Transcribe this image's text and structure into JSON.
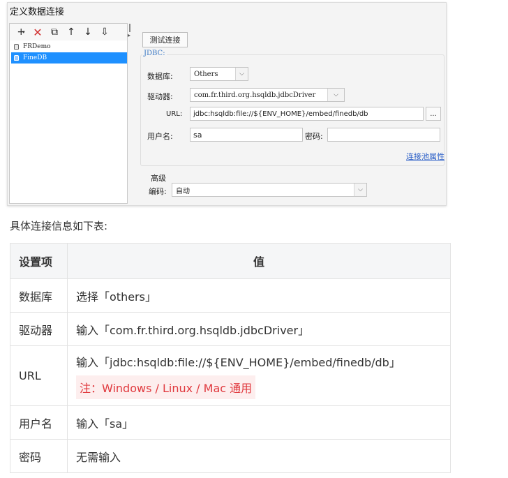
{
  "dialog": {
    "title": "定义数据连接",
    "toolbar": {
      "add": "+",
      "delete": "✕",
      "copy": "⧉",
      "up": "↑",
      "down": "↓",
      "sort": "⇩"
    },
    "connections": [
      "FRDemo",
      "FineDB"
    ],
    "test_button": "测试连接",
    "jdbc_legend": "JDBC:",
    "database_label": "数据库:",
    "database_value": "Others",
    "driver_label": "驱动器:",
    "driver_value": "com.fr.third.org.hsqldb.jdbcDriver",
    "url_label": "URL:",
    "url_value": "jdbc:hsqldb:file://${ENV_HOME}/embed/finedb/db",
    "url_browse": "...",
    "username_label": "用户名:",
    "username_value": "sa",
    "password_label": "密码:",
    "password_value": "",
    "pool_link": "连接池属性",
    "advanced_label": "高级",
    "encoding_label": "编码:",
    "encoding_value": "自动"
  },
  "intro": "具体连接信息如下表:",
  "table": {
    "headers": [
      "设置项",
      "值"
    ],
    "rows": [
      {
        "key": "数据库",
        "value": "选择「others」"
      },
      {
        "key": "驱动器",
        "value": "输入「com.fr.third.org.hsqldb.jdbcDriver」"
      },
      {
        "key": "URL",
        "value": "输入「jdbc:hsqldb:file://${ENV_HOME}/embed/finedb/db」",
        "note": "注：Windows / Linux / Mac 通用"
      },
      {
        "key": "用户名",
        "value": "输入「sa」"
      },
      {
        "key": "密码",
        "value": "无需输入"
      }
    ]
  },
  "colors": {
    "selection": "#1e90ff",
    "link": "#2b5fc7",
    "note_text": "#e0393e",
    "note_bg": "#fdeeee"
  }
}
